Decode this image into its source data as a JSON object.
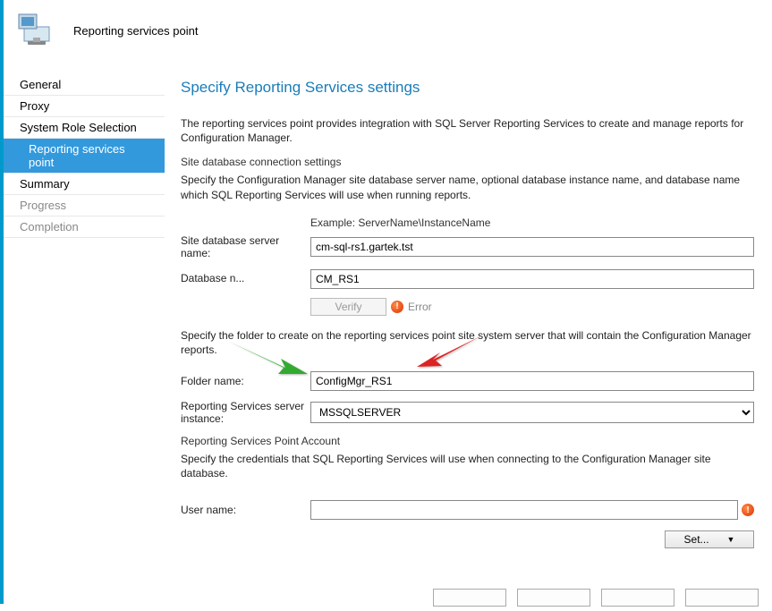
{
  "header": {
    "title": "Reporting services point"
  },
  "sidebar": {
    "items": [
      {
        "label": "General",
        "selected": false,
        "dim": false
      },
      {
        "label": "Proxy",
        "selected": false,
        "dim": false
      },
      {
        "label": "System Role Selection",
        "selected": false,
        "dim": false
      },
      {
        "label": "Reporting services point",
        "selected": true,
        "dim": false
      },
      {
        "label": "Summary",
        "selected": false,
        "dim": false
      },
      {
        "label": "Progress",
        "selected": false,
        "dim": true
      },
      {
        "label": "Completion",
        "selected": false,
        "dim": true
      }
    ]
  },
  "content": {
    "page_title": "Specify Reporting Services settings",
    "intro": "The reporting services point provides integration with SQL Server Reporting Services to create and manage reports for Configuration Manager.",
    "section1_title": "Site database connection settings",
    "section1_desc": "Specify the Configuration Manager site database server name, optional database instance name, and database name which SQL Reporting Services will use when running reports.",
    "example_label": "Example: ServerName\\InstanceName",
    "server_label": "Site database server name:",
    "server_value": "cm-sql-rs1.gartek.tst",
    "dbname_label": "Database n...",
    "dbname_value": "CM_RS1",
    "verify_label": "Verify",
    "error_text": "Error",
    "folder_desc": "Specify the folder to create on the reporting services point site system server that will contain the Configuration Manager reports.",
    "folder_label": "Folder name:",
    "folder_value": "ConfigMgr_RS1",
    "instance_label": "Reporting Services server instance:",
    "instance_value": "MSSQLSERVER",
    "section2_title": "Reporting Services Point Account",
    "section2_desc": "Specify the credentials that SQL Reporting Services will use when connecting to the Configuration Manager site database.",
    "username_label": "User name:",
    "username_value": "",
    "set_label": "Set..."
  }
}
